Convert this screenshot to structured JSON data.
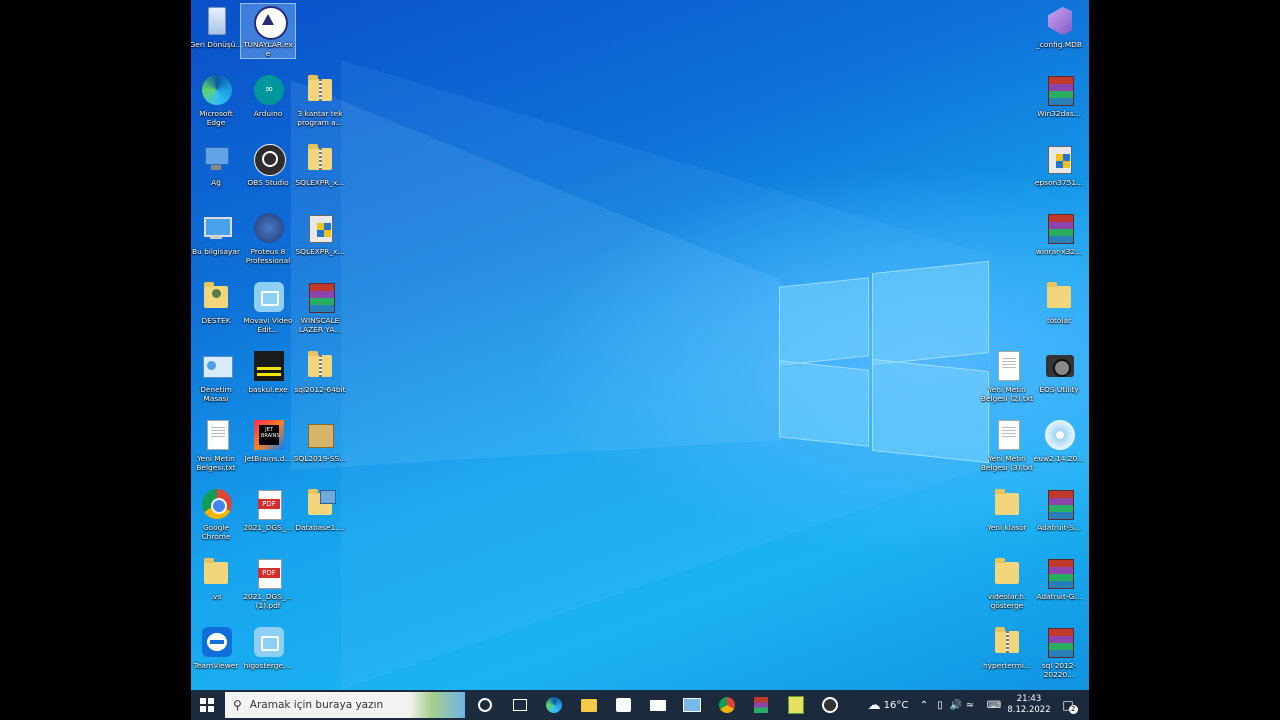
{
  "desktop": {
    "left_icons": [
      {
        "label": "Geri Dönüşü...",
        "icon": "recycle-bin-icon",
        "col": 0,
        "row": 0
      },
      {
        "label": "TUNAYLAR.exe",
        "icon": "tunaylar-app-icon",
        "col": 1,
        "row": 0,
        "selected": true
      },
      {
        "label": "Microsoft Edge",
        "icon": "edge-icon",
        "col": 0,
        "row": 1
      },
      {
        "label": "Arduino",
        "icon": "arduino-icon",
        "col": 1,
        "row": 1
      },
      {
        "label": "3 kantar tek program a...",
        "icon": "zip-folder-icon",
        "col": 2,
        "row": 1
      },
      {
        "label": "Ağ",
        "icon": "network-icon",
        "col": 0,
        "row": 2
      },
      {
        "label": "OBS Studio",
        "icon": "obs-icon",
        "col": 1,
        "row": 2
      },
      {
        "label": "SQLEXPR_x...",
        "icon": "zip-folder-icon",
        "col": 2,
        "row": 2
      },
      {
        "label": "Bu bilgisayar",
        "icon": "computer-icon",
        "col": 0,
        "row": 3
      },
      {
        "label": "Proteus 8 Professional",
        "icon": "proteus-icon",
        "col": 1,
        "row": 3
      },
      {
        "label": "SQLEXPR_x...",
        "icon": "installer-icon",
        "col": 2,
        "row": 3
      },
      {
        "label": "DESTEK",
        "icon": "user-folder-icon",
        "col": 0,
        "row": 4
      },
      {
        "label": "Movavi Video Edit...",
        "icon": "movavi-icon",
        "col": 1,
        "row": 4
      },
      {
        "label": "WINSCALE LAZER YA...",
        "icon": "rar-icon",
        "col": 2,
        "row": 4
      },
      {
        "label": "Denetim Masası",
        "icon": "control-panel-icon",
        "col": 0,
        "row": 5
      },
      {
        "label": "baskul.exe",
        "icon": "exe-icon",
        "col": 1,
        "row": 5
      },
      {
        "label": "sql2012-64bit",
        "icon": "zip-folder-icon",
        "col": 2,
        "row": 5
      },
      {
        "label": "Yeni Metin Belgesi.txt",
        "icon": "text-file-icon",
        "col": 0,
        "row": 6
      },
      {
        "label": "JetBrains.d...",
        "icon": "jetbrains-icon",
        "col": 1,
        "row": 6
      },
      {
        "label": "SQL2019-SS...",
        "icon": "installer-box-icon",
        "col": 2,
        "row": 6
      },
      {
        "label": "Google Chrome",
        "icon": "chrome-icon",
        "col": 0,
        "row": 7
      },
      {
        "label": "2021_DGS_...",
        "icon": "pdf-icon",
        "col": 1,
        "row": 7
      },
      {
        "label": "Database1....",
        "icon": "database-icon",
        "col": 2,
        "row": 7
      },
      {
        "label": ".vs",
        "icon": "folder-icon",
        "col": 0,
        "row": 8
      },
      {
        "label": "2021_DGS_... (1).pdf",
        "icon": "pdf-icon",
        "col": 1,
        "row": 8
      },
      {
        "label": "TeamViewer",
        "icon": "teamviewer-icon",
        "col": 0,
        "row": 9
      },
      {
        "label": "higosterge....",
        "icon": "movavi-icon",
        "col": 1,
        "row": 9
      }
    ],
    "right_icons": [
      {
        "label": "_config.MDB",
        "icon": "visual-studio-icon",
        "col": 1,
        "row": 0
      },
      {
        "label": "Win32das...",
        "icon": "rar-icon",
        "col": 1,
        "row": 1
      },
      {
        "label": "epson3751...",
        "icon": "installer-icon",
        "col": 1,
        "row": 2
      },
      {
        "label": "winrar-x32...",
        "icon": "rar-icon",
        "col": 1,
        "row": 3
      },
      {
        "label": "fotolar",
        "icon": "folder-icon",
        "col": 1,
        "row": 4
      },
      {
        "label": "Yeni Metin Belgesi (2).txt",
        "icon": "text-file-icon",
        "col": 0,
        "row": 5
      },
      {
        "label": "EOS Utility",
        "icon": "camera-icon",
        "col": 1,
        "row": 5
      },
      {
        "label": "Yeni Metin Belgesi (3).txt",
        "icon": "text-file-icon",
        "col": 0,
        "row": 6
      },
      {
        "label": "euw2.14.20...",
        "icon": "disc-icon",
        "col": 1,
        "row": 6
      },
      {
        "label": "Yeni klasör",
        "icon": "folder-icon",
        "col": 0,
        "row": 7
      },
      {
        "label": "Adafruit-S...",
        "icon": "rar-icon",
        "col": 1,
        "row": 7
      },
      {
        "label": "videolar.h. gösterge",
        "icon": "folder-icon",
        "col": 0,
        "row": 8
      },
      {
        "label": "Adafruit-G...",
        "icon": "rar-icon",
        "col": 1,
        "row": 8
      },
      {
        "label": "hypertermi...",
        "icon": "zip-folder-icon",
        "col": 0,
        "row": 9
      },
      {
        "label": "sql 2012-20220...",
        "icon": "rar-icon",
        "col": 1,
        "row": 9
      }
    ]
  },
  "taskbar": {
    "search_placeholder": "Aramak için buraya yazın",
    "weather_temp": "16°C",
    "time": "21:43",
    "date": "8.12.2022",
    "notification_count": "2",
    "pinned": [
      "cortana-icon",
      "task-view-icon",
      "edge-icon",
      "file-explorer-icon",
      "store-icon",
      "mail-icon",
      "remote-desktop-icon",
      "chrome-icon",
      "winrar-icon",
      "notepad-plus-icon",
      "recorder-icon"
    ]
  },
  "colors": {
    "taskbar_bg": "#1b2a3c",
    "desktop_accent": "#1ba4f0"
  }
}
